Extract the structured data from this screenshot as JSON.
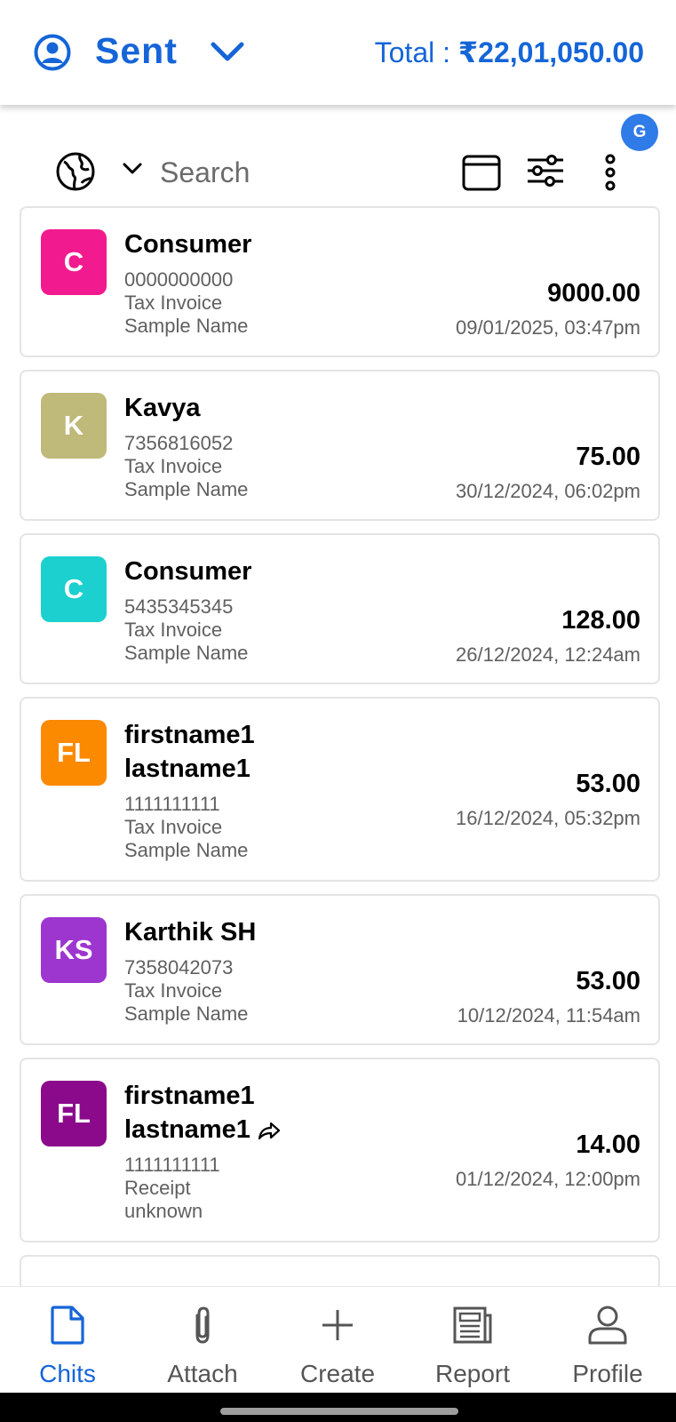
{
  "header": {
    "title": "Sent",
    "total_label": "Total : ",
    "total_value": "₹22,01,050.00"
  },
  "avatar_initial": "G",
  "toolbar": {
    "search_placeholder": "Search"
  },
  "invoices": [
    {
      "initials": "C",
      "name": "Consumer",
      "phone": "0000000000",
      "type": "Tax Invoice",
      "ref": "Sample Name",
      "amount": "9000.00",
      "datetime": "09/01/2025, 03:47pm",
      "color": "#f21a8f"
    },
    {
      "initials": "K",
      "name": "Kavya",
      "phone": "7356816052",
      "type": "Tax Invoice",
      "ref": "Sample Name",
      "amount": "75.00",
      "datetime": "30/12/2024, 06:02pm",
      "color": "#bfb97a"
    },
    {
      "initials": "C",
      "name": "Consumer",
      "phone": "5435345345",
      "type": "Tax Invoice",
      "ref": "Sample Name",
      "amount": "128.00",
      "datetime": "26/12/2024, 12:24am",
      "color": "#1cd0cf"
    },
    {
      "initials": "FL",
      "name": "firstname1 lastname1",
      "phone": "1111111111",
      "type": "Tax Invoice",
      "ref": "Sample Name",
      "amount": "53.00",
      "datetime": "16/12/2024, 05:32pm",
      "color": "#fb8a00"
    },
    {
      "initials": "KS",
      "name": "Karthik SH",
      "phone": "7358042073",
      "type": "Tax Invoice",
      "ref": "Sample Name",
      "amount": "53.00",
      "datetime": "10/12/2024, 11:54am",
      "color": "#9d35cf"
    },
    {
      "initials": "FL",
      "name": "firstname1 lastname1",
      "phone": "1111111111",
      "type": "Receipt",
      "ref": "unknown",
      "amount": "14.00",
      "datetime": "01/12/2024, 12:00pm",
      "color": "#8b0a8b",
      "shared": true
    }
  ],
  "nav": [
    {
      "label": "Chits",
      "icon": "document-icon",
      "active": true
    },
    {
      "label": "Attach",
      "icon": "paperclip-icon"
    },
    {
      "label": "Create",
      "icon": "plus-icon"
    },
    {
      "label": "Report",
      "icon": "newspaper-icon"
    },
    {
      "label": "Profile",
      "icon": "person-icon"
    }
  ],
  "colors": {
    "accent": "#1565d8"
  }
}
